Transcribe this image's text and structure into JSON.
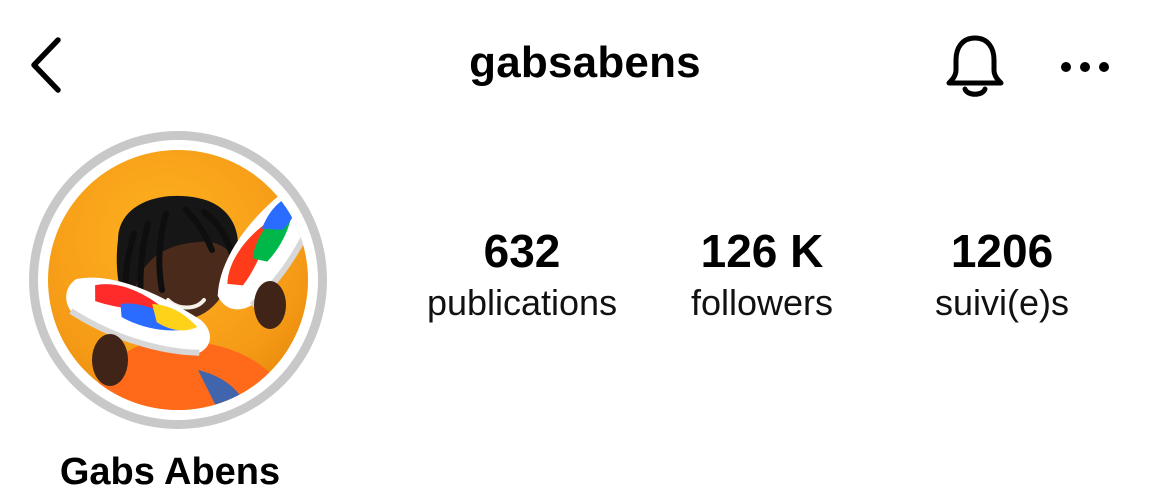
{
  "header": {
    "back_icon": "chevron-left-icon",
    "username": "gabsabens",
    "bell_icon": "bell-icon",
    "more_icon": "ellipsis-icon"
  },
  "profile": {
    "display_name": "Gabs Abens",
    "avatar": {
      "description_icon": "profile-photo",
      "ring_color": "#c8c8c8",
      "background_color": "#f59a16"
    }
  },
  "stats": {
    "posts": {
      "value": "632",
      "label": "publications"
    },
    "followers": {
      "value": "126 K",
      "label": "followers"
    },
    "following": {
      "value": "1206",
      "label": "suivi(e)s"
    }
  },
  "colors": {
    "text": "#000000",
    "background": "#ffffff"
  }
}
